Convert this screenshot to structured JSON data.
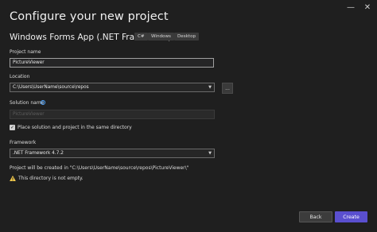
{
  "window": {
    "minimize_glyph": "—",
    "close_glyph": "✕"
  },
  "header": {
    "title": "Configure your new project",
    "template_name": "Windows Forms App (.NET Framework)",
    "tags": [
      "C#",
      "Windows",
      "Desktop"
    ]
  },
  "form": {
    "project_name_label": "Project name",
    "project_name_value": "PictureViewer",
    "location_label": "Location",
    "location_value": "C:\\Users\\UserName\\source\\repos",
    "browse_label": "...",
    "solution_name_label": "Solution name",
    "solution_name_placeholder": "PictureViewer",
    "checkbox_label": "Place solution and project in the same directory",
    "checkbox_checked": true,
    "framework_label": "Framework",
    "framework_value": ".NET Framework 4.7.2",
    "info_text": "Project will be created in \"C:\\Users\\UserName\\source\\repos\\PictureViewer\\\"",
    "warning_text": "This directory is not empty."
  },
  "footer": {
    "back_label": "Back",
    "create_label": "Create"
  },
  "colors": {
    "accent": "#5a4fcf",
    "warning": "#f2c94c",
    "info": "#4aa3ff"
  }
}
